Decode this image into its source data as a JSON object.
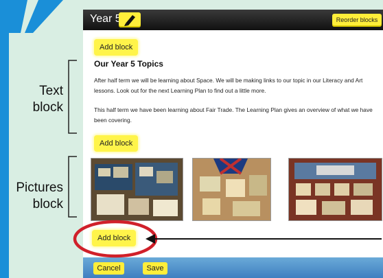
{
  "annotations": {
    "text_block_line1": "Text",
    "text_block_line2": "block",
    "pictures_block_line1": "Pictures",
    "pictures_block_line2": "block"
  },
  "app": {
    "title": "Year 5",
    "reorder_label": "Reorder blocks",
    "add_block_label": "Add block",
    "section_title": "Our Year 5 Topics",
    "paragraphs": [
      "After half term we will be learning about Space. We will be making links to our topic in our Literacy and Art lessons. Look out for the next Learning Plan to find out a little more.",
      "This half term we have been learning about Fair Trade. The Learning Plan gives an overview of what we have been covering."
    ],
    "footer": {
      "cancel_label": "Cancel",
      "save_label": "Save"
    }
  },
  "colors": {
    "accent_yellow": "#ffee3a",
    "footer_blue": "#4f8fcc",
    "highlight_red": "#d0202a",
    "margin_blue": "#1a8fd8"
  },
  "icons": {
    "edit": "pencil-icon",
    "arrow": "arrow-left-icon"
  }
}
